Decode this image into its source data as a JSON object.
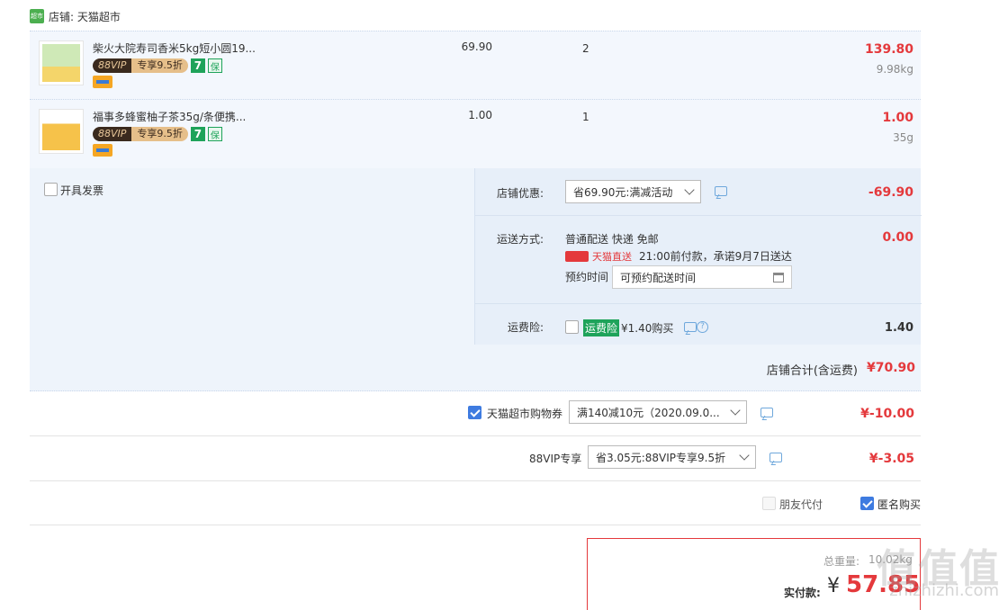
{
  "shop": {
    "logo_text": "超市",
    "label": "店铺: 天猫超市"
  },
  "items": [
    {
      "title": "柴火大院寿司香米5kg短小圆19...",
      "vip_left": "88VIP",
      "vip_right": "专享9.5折",
      "badge_seven": "7",
      "badge_extra": "保",
      "price": "69.90",
      "qty": "2",
      "total": "139.80",
      "weight": "9.98kg"
    },
    {
      "title": "福事多蜂蜜柚子茶35g/条便携...",
      "vip_left": "88VIP",
      "vip_right": "专享9.5折",
      "badge_seven": "7",
      "badge_extra": "保",
      "price": "1.00",
      "qty": "1",
      "total": "1.00",
      "weight": "35g"
    }
  ],
  "invoice": {
    "label": "开具发票"
  },
  "shop_discount": {
    "label": "店铺优惠:",
    "selected": "省69.90元:满减活动",
    "amount": "-69.90"
  },
  "shipping": {
    "label": "运送方式:",
    "method": "普通配送 快递 免邮",
    "direct_label": "天猫直送",
    "promise": "21:00前付款，承诺9月7日送达",
    "schedule_label": "预约时间",
    "schedule_value": "可预约配送时间",
    "amount": "0.00"
  },
  "insurance": {
    "label": "运费险:",
    "tag": "运费险",
    "price_text": "¥1.40购买",
    "amount": "1.40"
  },
  "subtotal": {
    "label": "店铺合计(含运费)",
    "amount": "¥70.90"
  },
  "voucher": {
    "label": "天猫超市购物券",
    "selected": "满140减10元（2020.09.0...",
    "amount": "¥-10.00"
  },
  "vip88": {
    "label": "88VIP专享",
    "selected": "省3.05元:88VIP专享9.5折",
    "amount": "¥-3.05"
  },
  "friend_pay": {
    "label": "朋友代付"
  },
  "anonymous": {
    "label": "匿名购买"
  },
  "summary": {
    "weight_label": "总重量:",
    "weight_value": "10.02kg",
    "pay_label": "实付款:",
    "currency": "¥",
    "pay_amount": "57.85"
  },
  "watermark": {
    "text": "值值值",
    "url": "zhizhizhi.com"
  }
}
